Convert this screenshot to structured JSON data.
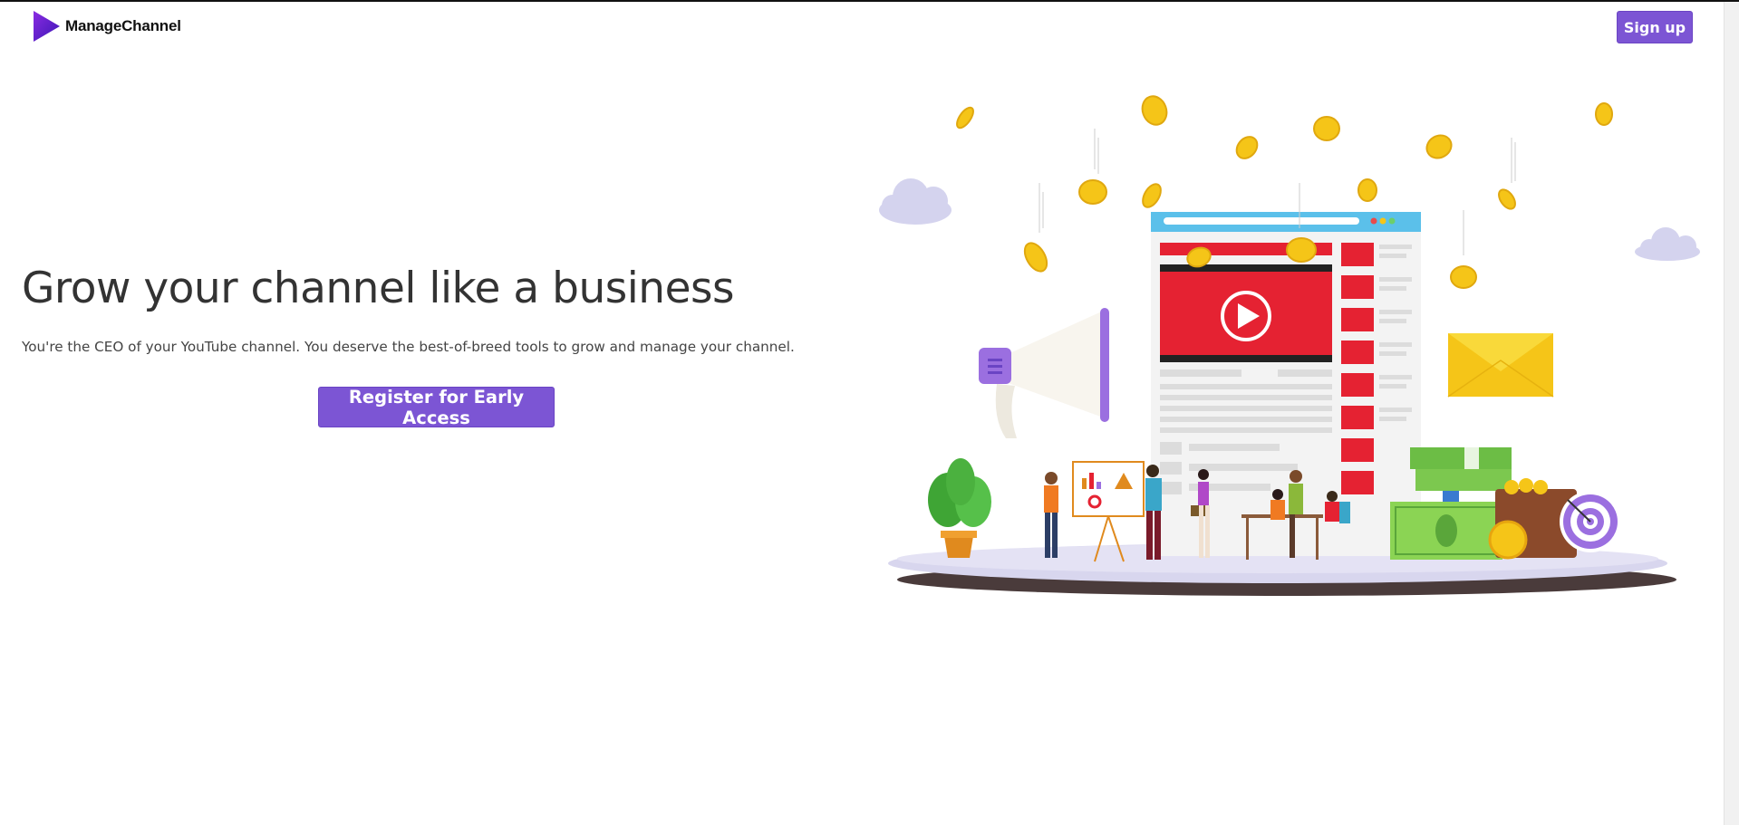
{
  "brand": {
    "name": "ManageChannel",
    "logo_icon": "play-triangle-logo",
    "logo_color": "#6a2bd8"
  },
  "nav": {
    "signup_label": "Sign up"
  },
  "hero": {
    "title": "Grow your channel like a business",
    "subtitle": "You're the CEO of your YouTube channel. You deserve the best-of-breed tools to grow and manage your channel.",
    "cta_label": "Register for Early Access"
  },
  "illustration": {
    "description_icon": "channel-growth-illustration"
  },
  "colors": {
    "accent": "#7c55d4",
    "title_text": "#333333",
    "video_red": "#e52232",
    "coin_gold": "#f5c518",
    "cloud": "#d4d3ee"
  }
}
